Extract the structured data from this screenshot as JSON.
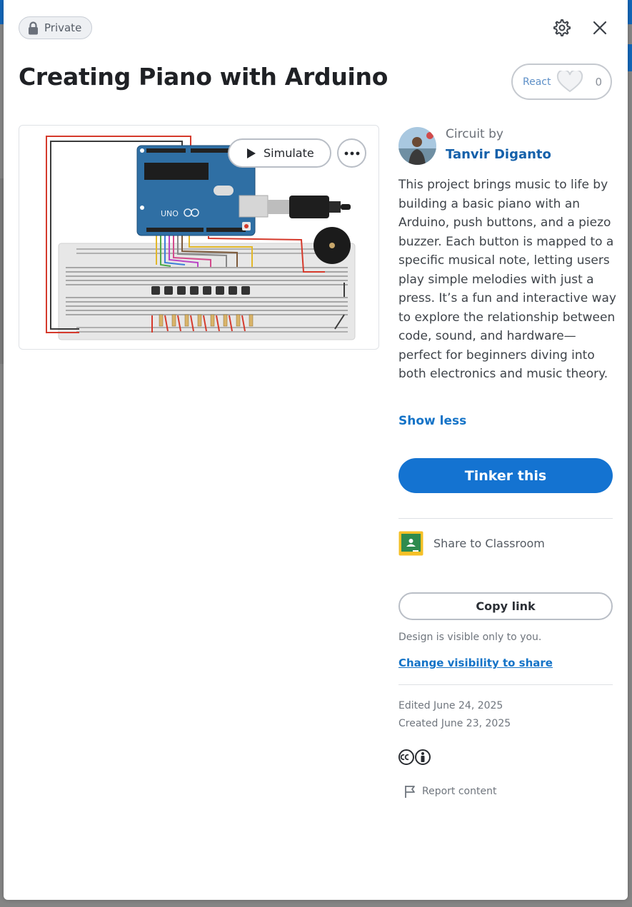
{
  "badge": {
    "label": "Private",
    "icon": "lock-icon"
  },
  "header": {
    "title": "Creating Piano with Arduino",
    "settings_icon": "gear-icon",
    "close_icon": "close-icon"
  },
  "react": {
    "label": "React",
    "count": "0",
    "icon": "heart-icon"
  },
  "preview": {
    "simulate_label": "Simulate",
    "more_icon": "more-icon"
  },
  "author": {
    "prefix": "Circuit by",
    "name": "Tanvir Diganto"
  },
  "description": "This project brings music to life by building a basic piano with an Arduino, push buttons, and a piezo buzzer. Each button is mapped to a specific musical note, letting users play simple melodies with just a press. It’s a fun and interactive way to explore the relationship between code, sound, and hardware—perfect for beginners diving into both electronics and music theory.",
  "show_less": "Show less",
  "tinker_label": "Tinker this",
  "share": {
    "classroom_label": "Share to Classroom"
  },
  "copy_link_label": "Copy link",
  "visibility": {
    "note": "Design is visible only to you.",
    "change_label": "Change visibility to share"
  },
  "dates": {
    "edited": "Edited June 24, 2025",
    "created": "Created June 23, 2025"
  },
  "report_label": "Report content",
  "colors": {
    "accent": "#1473d1",
    "link": "#1473c7",
    "author": "#1460aa",
    "title": "#1f2125"
  }
}
